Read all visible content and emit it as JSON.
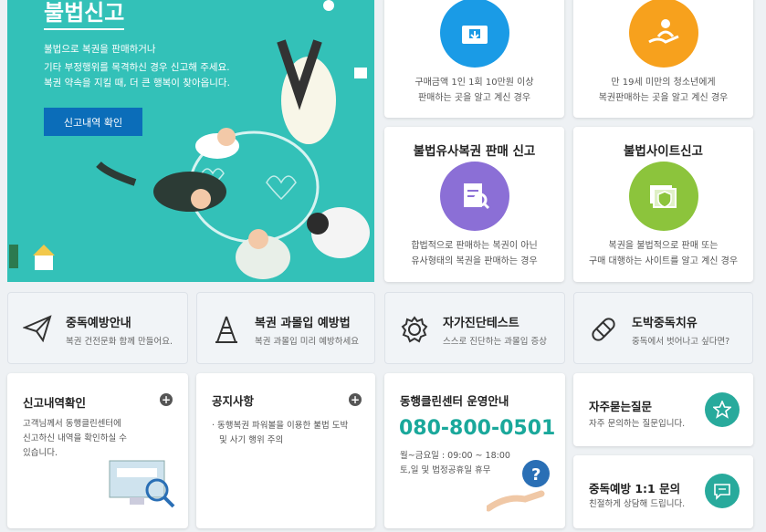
{
  "hero": {
    "title": "불법신고",
    "lines": [
      "불법으로 복권을 판매하거나",
      "기타 부정행위를 목격하신 경우 신고해 주세요.",
      "복권 약속을 지킬 때, 더 큰 행복이 찾아옵니다."
    ],
    "button_label": "신고내역 확인"
  },
  "report_cards": [
    {
      "title": "",
      "desc": [
        "구매금액 1인 1회 10만원 이상",
        "판매하는 곳을 알고 계신 경우"
      ],
      "icon": "wallet-icon",
      "color": "#1a9be6"
    },
    {
      "title": "",
      "desc": [
        "만 19세 미만의 청소년에게",
        "복권판매하는 곳을 알고 계신 경우"
      ],
      "icon": "hand-child-icon",
      "color": "#f7a11d"
    },
    {
      "title": "불법유사복권 판매 신고",
      "desc": [
        "합법적으로 판매하는 복권이 아닌",
        "유사형태의 복권을 판매하는 경우"
      ],
      "icon": "ticket-search-icon",
      "color": "#8b6fd6"
    },
    {
      "title": "불법사이트신고",
      "desc": [
        "복권을 불법적으로 판매 또는",
        "구매 대행하는 사이트를 알고 계신 경우"
      ],
      "icon": "shield-site-icon",
      "color": "#8cc43c"
    }
  ],
  "tiles": [
    {
      "title": "중독예방안내",
      "sub": "복권 건전문화 함께 만들어요.",
      "icon": "paper-plane-icon"
    },
    {
      "title": "복권 과몰입 예방법",
      "sub": "복권 과몰입 미리 예방하세요",
      "icon": "tower-icon"
    },
    {
      "title": "자가진단테스트",
      "sub": "스스로 진단하는 과몰입 증상",
      "icon": "gear-icon"
    },
    {
      "title": "도박중독치유",
      "sub": "중독에서 벗어나고 싶다면?",
      "icon": "bandage-icon"
    }
  ],
  "report_history": {
    "title": "신고내역확인",
    "desc": [
      "고객님께서 동행클린센터에",
      "신고하신 내역을 확인하실 수",
      "있습니다."
    ]
  },
  "notice": {
    "title": "공지사항",
    "items": [
      "동행복권 파워볼을 이용한 불법 도박",
      "및 사기 행위 주의"
    ]
  },
  "center": {
    "title": "동행클린센터 운영안내",
    "phone": "080-800-0501",
    "hours": "월~금요일 : 09:00 ~ 18:00",
    "closed": "토,일 및 법정공휴일 휴무"
  },
  "faq": {
    "title": "자주묻는질문",
    "sub": "자주 문의하는 질문입니다."
  },
  "consult": {
    "title": "중독예방 1:1 문의",
    "sub": "친절하게 상담해 드립니다."
  },
  "accent": "#1aa89b"
}
